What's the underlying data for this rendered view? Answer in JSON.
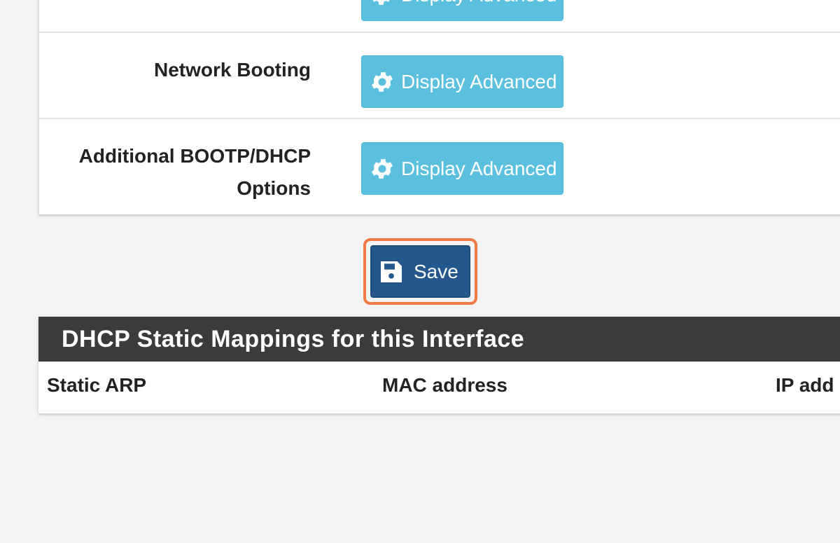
{
  "settings": {
    "rows": [
      {
        "label": "",
        "button_label": "Display Advanced"
      },
      {
        "label": "Network Booting",
        "button_label": "Display Advanced"
      },
      {
        "label": "Additional BOOTP/DHCP Options",
        "button_label": "Display Advanced"
      }
    ]
  },
  "actions": {
    "save_label": "Save"
  },
  "static_mappings": {
    "title": "DHCP Static Mappings for this Interface",
    "columns": [
      "Static ARP",
      "MAC address",
      "IP add"
    ]
  },
  "colors": {
    "info_button": "#5bc0de",
    "primary_button": "#24578b",
    "highlight": "#f07b45",
    "panel_heading": "#3b3b3b"
  },
  "icons": {
    "advanced": "gear-icon",
    "save": "floppy-disk-icon"
  }
}
